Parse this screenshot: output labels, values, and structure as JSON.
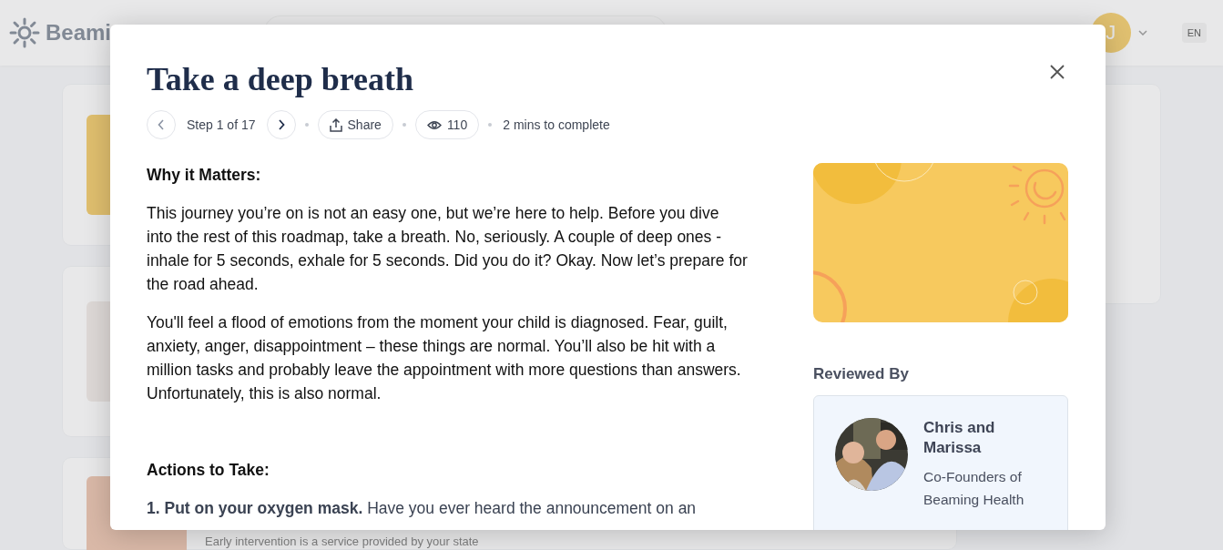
{
  "background": {
    "logo": "Beami",
    "avatar": "J",
    "language": "EN",
    "snippet": "Early intervention is a service provided by your state"
  },
  "modal": {
    "title": "Take a deep breath",
    "step": "Step 1 of 17",
    "share": "Share",
    "views": "110",
    "duration": "2 mins to complete",
    "sections": [
      {
        "kind": "heading",
        "text": "Why it Matters:"
      },
      {
        "kind": "paragraph",
        "text": "This journey you’re on is not an easy one, but we’re here to help. Before you dive into the rest of this roadmap, take a breath. No, seriously. A couple of deep ones - inhale for 5 seconds, exhale for 5 seconds. Did you do it? Okay. Now let’s prepare for the road ahead."
      },
      {
        "kind": "paragraph",
        "text": "You'll feel a flood of emotions from the moment your child is diagnosed. Fear, guilt, anxiety, anger, disappointment – these things are normal. You’ll also be hit with a million tasks and probably leave the appointment with more questions than answers. Unfortunately, this is also normal."
      },
      {
        "kind": "heading",
        "text": "**Actions to Take**:"
      },
      {
        "kind": "item",
        "text": "**1. Put on your oxygen mask.** Have you ever heard the announcement on an"
      }
    ],
    "reviewed_by": {
      "heading": "Reviewed By",
      "name": "Chris and Marissa",
      "role": "Co-Founders of Beaming Health"
    }
  }
}
